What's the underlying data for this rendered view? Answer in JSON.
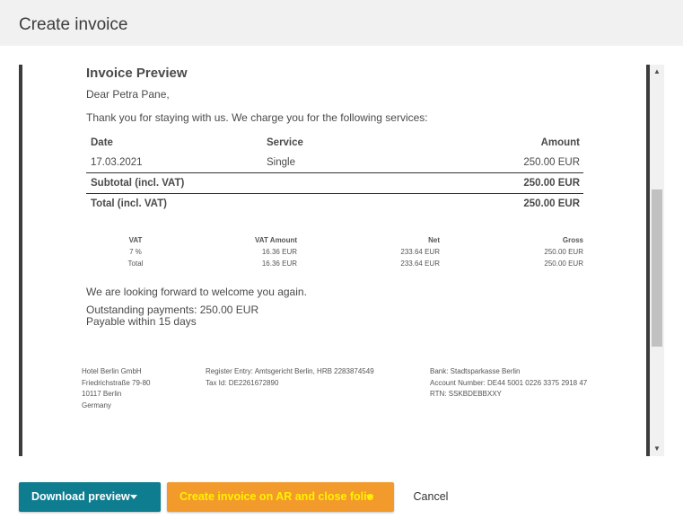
{
  "dialog": {
    "title": "Create invoice"
  },
  "preview": {
    "title": "Invoice Preview",
    "greeting": "Dear Petra Pane,",
    "intro": "Thank you for staying with us. We charge you for the following services:",
    "services": {
      "headers": {
        "date": "Date",
        "service": "Service",
        "amount": "Amount"
      },
      "rows": [
        {
          "date": "17.03.2021",
          "service": "Single",
          "amount": "250.00 EUR"
        }
      ],
      "subtotal": {
        "label": "Subtotal (incl. VAT)",
        "amount": "250.00 EUR"
      },
      "total": {
        "label": "Total (incl. VAT)",
        "amount": "250.00 EUR"
      }
    },
    "vat": {
      "headers": {
        "vat": "VAT",
        "vat_amount": "VAT Amount",
        "net": "Net",
        "gross": "Gross"
      },
      "rows": [
        {
          "vat": "7 %",
          "vat_amount": "16.36 EUR",
          "net": "233.64 EUR",
          "gross": "250.00 EUR"
        },
        {
          "vat": "Total",
          "vat_amount": "16.36 EUR",
          "net": "233.64 EUR",
          "gross": "250.00 EUR"
        }
      ]
    },
    "closing": "We are looking forward to welcome you again.",
    "outstanding": "Outstanding payments: 250.00 EUR",
    "payable": "Payable within 15 days",
    "footer": {
      "address": [
        "Hotel Berlin GmbH",
        "Friedrichstraße 79-80",
        "10117 Berlin",
        "Germany"
      ],
      "register": [
        "Register Entry: Amtsgericht Berlin, HRB 2283874549",
        "Tax Id: DE2261672890"
      ],
      "bank": [
        "Bank: Stadtsparkasse Berlin",
        "Account Number: DE44 5001 0226 3375 2918 47",
        "RTN: SSKBDEBBXXY"
      ]
    }
  },
  "scrollbar": {
    "up_arrow": "▲",
    "down_arrow": "▼"
  },
  "actions": {
    "download_label": "Download preview",
    "create_label": "Create invoice on AR and close folio",
    "cancel_label": "Cancel"
  },
  "colors": {
    "download_button": "#0e7d8f",
    "create_button": "#f39a2c",
    "create_text": "#fff200",
    "header_bg": "#f1f1f2"
  }
}
